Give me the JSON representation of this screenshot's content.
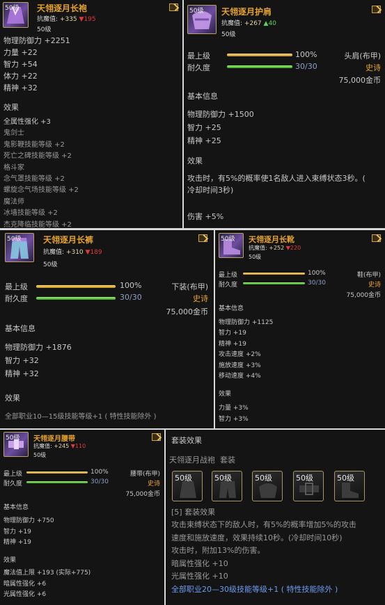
{
  "robe": {
    "name": "天翎逐月长袍",
    "level_badge": "50级",
    "resist_label": "抗魔值:",
    "resist_up": "+335",
    "resist_down": "▼195",
    "level": "50级",
    "stats": [
      "物理防御力 +2251",
      "力量 +22",
      "智力 +54",
      "体力 +22",
      "精神 +32"
    ],
    "effects_header": "效果",
    "effects": [
      "全属性强化 +3",
      "鬼剑士",
      "鬼影鞭技能等级 +2",
      "死亡之碑技能等级 +2",
      "格斗家",
      "念气罩技能等级 +2",
      "螺旋念气场技能等级 +2",
      "魔法师",
      "冰墙技能等级 +2",
      "杰克降临技能等级 +2"
    ]
  },
  "shoulder": {
    "name": "天翎逐月护肩",
    "level_badge": "50级",
    "resist_label": "抗魔值:",
    "resist_up": "+267",
    "resist_up2": "▲40",
    "level": "50级",
    "top_level_label": "最上级",
    "top_level_value": "100%",
    "top_level_pct": 1.0,
    "durability_label": "耐久度",
    "durability_value": "30/30",
    "durability_pct": 1.0,
    "slot": "头肩(布甲)",
    "rarity": "史诗",
    "price": "75,000金币",
    "basic_header": "基本信息",
    "stats": [
      "物理防御力 +1500",
      "智力 +25",
      "精神 +25"
    ],
    "effects_header": "效果",
    "effect_lines": [
      "攻击时，有5%的概率使1名敌人进入束缚状态3秒。(",
      "冷却时间3秒)"
    ],
    "damage": "伤害 +5%"
  },
  "pants": {
    "name": "天翎逐月长裤",
    "level_badge": "50级",
    "resist_label": "抗魔值:",
    "resist_up": "+310",
    "resist_down": "▼189",
    "level": "50级",
    "top_level_label": "最上级",
    "top_level_value": "100%",
    "top_level_pct": 1.0,
    "durability_label": "耐久度",
    "durability_value": "30/30",
    "durability_pct": 1.0,
    "slot": "下装(布甲)",
    "rarity": "史诗",
    "price": "75,000金币",
    "basic_header": "基本信息",
    "stats": [
      "物理防御力 +1876",
      "智力 +32",
      "精神 +32"
    ],
    "effects_header": "效果",
    "effect_line": "全部职业10—15级技能等级+1 ( 特性技能除外 )"
  },
  "shoes": {
    "name": "天翎逐月长靴",
    "level_badge": "50级",
    "resist_label": "抗魔值:",
    "resist_up": "+252",
    "resist_down": "▼220",
    "level": "50级",
    "top_level_label": "最上级",
    "top_level_value": "100%",
    "top_level_pct": 1.0,
    "durability_label": "耐久度",
    "durability_value": "30/30",
    "durability_pct": 1.0,
    "slot": "鞋(布甲)",
    "rarity": "史诗",
    "price": "75,000金币",
    "basic_header": "基本信息",
    "stats": [
      "物理防御力 +1125",
      "智力 +19",
      "精神 +19",
      "攻击速度 +2%",
      "施放速度 +3%",
      "移动速度 +4%"
    ],
    "effects_header": "效果",
    "effects": [
      "力量 +3%",
      "智力 +3%"
    ]
  },
  "belt": {
    "name": "天翎逐月腰带",
    "level_badge": "50级",
    "resist_label": "抗魔值:",
    "resist_up": "+245",
    "resist_down": "▼110",
    "level": "50级",
    "top_level_label": "最上级",
    "top_level_value": "100%",
    "top_level_pct": 1.0,
    "durability_label": "耐久度",
    "durability_value": "30/30",
    "durability_pct": 1.0,
    "slot": "腰带(布甲)",
    "rarity": "史诗",
    "price": "75,000金币",
    "basic_header": "基本信息",
    "stats": [
      "物理防御力 +750",
      "智力 +19",
      "精神 +19"
    ],
    "effects_header": "效果",
    "effects": [
      "魔法值上限 +193 (实际+775)",
      "暗属性强化 +6",
      "光属性强化 +6"
    ]
  },
  "set": {
    "header": "套装效果",
    "set_name": "天翎逐月战袍",
    "set_suffix": "套装",
    "slot_badges": [
      "50级",
      "50级",
      "50级",
      "50级",
      "50级"
    ],
    "tier_label": "[5] 套装效果",
    "desc_lines": [
      "攻击束缚状态下的敌人时，有5%的概率增加5%的攻击",
      "速度和施放速度，效果持续10秒。(冷却时间10秒)",
      "攻击时，附加13%的伤害。"
    ],
    "bonus": [
      "暗属性强化 +10",
      "光属性强化 +10"
    ],
    "skill_line": "全部职业20—30级技能等级+1 ( 特性技能除外 )"
  },
  "colors": {
    "title": "#e6a32b",
    "epic": "#e6a32b",
    "up": "#5fd35f",
    "down": "#e03a3a",
    "skill": "#6d9cf0"
  }
}
